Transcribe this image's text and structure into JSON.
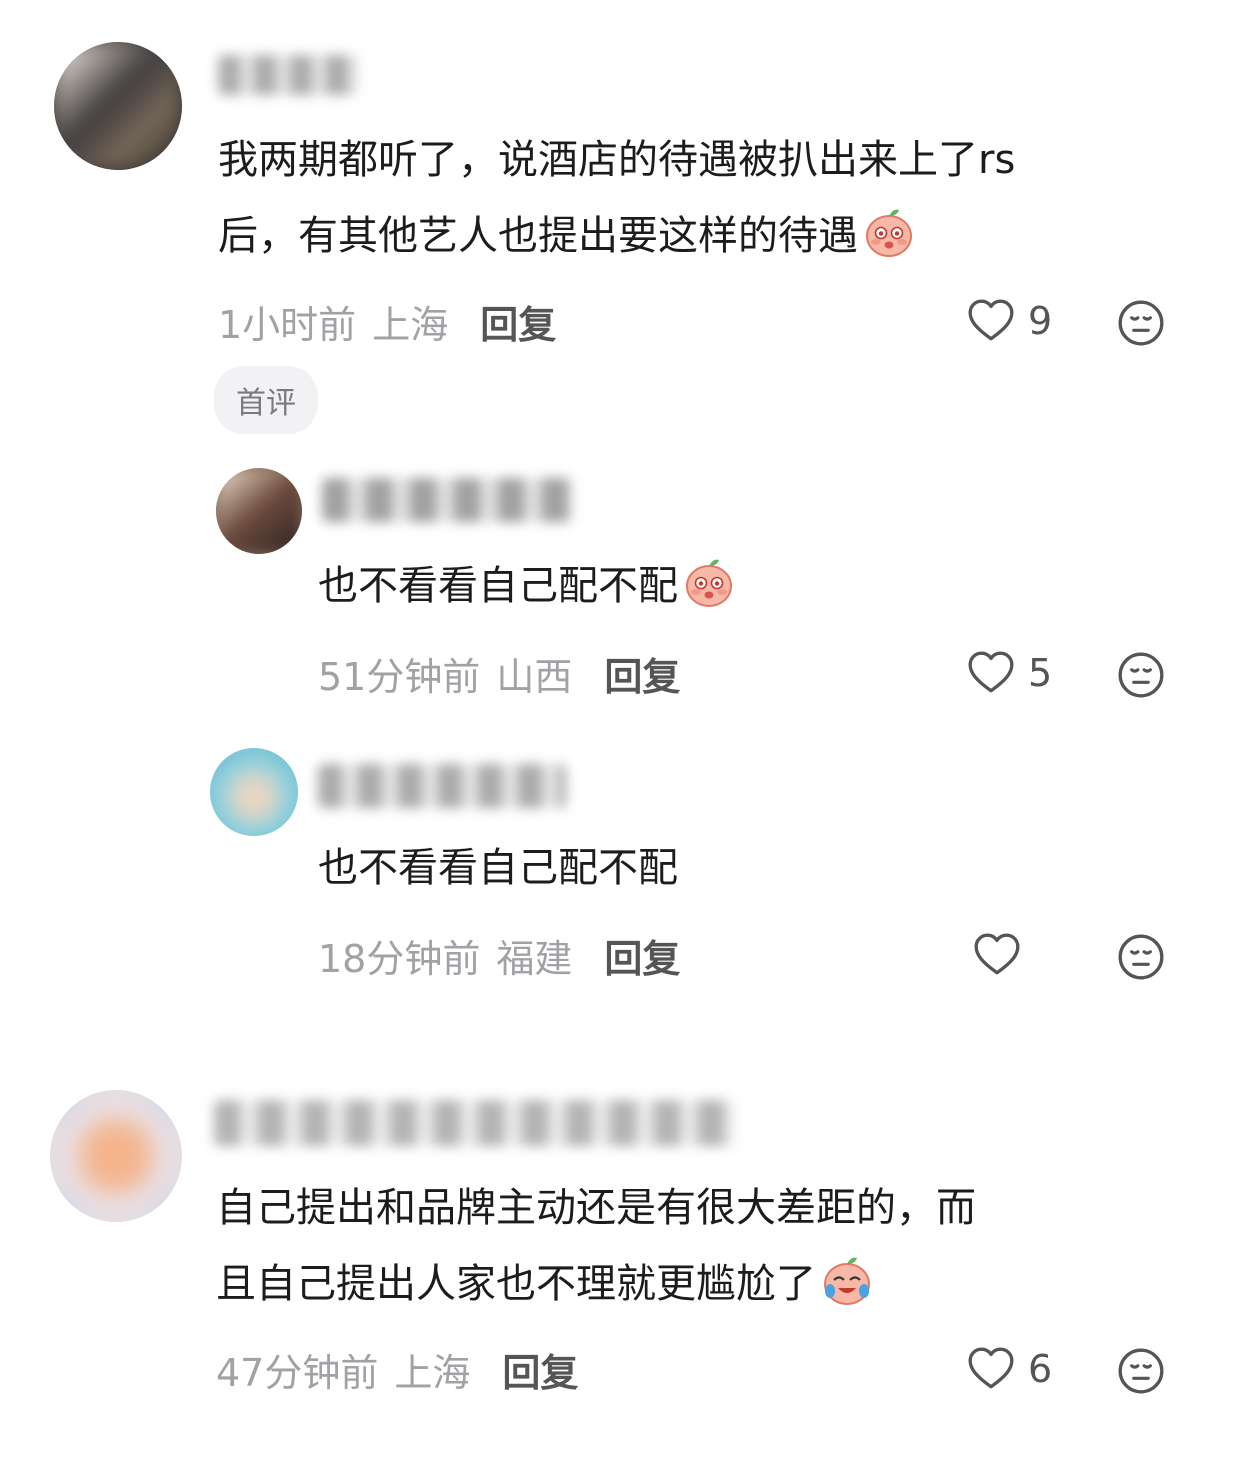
{
  "comments": [
    {
      "text_line1": "我两期都听了，说酒店的待遇被扒出来上了rs",
      "text_line2": "后，有其他艺人也提出要这样的待遇",
      "time": "1小时前",
      "location": "上海",
      "reply_label": "回复",
      "likes": "9",
      "badge": "首评",
      "replies": [
        {
          "text": "也不看看自己配不配",
          "time": "51分钟前",
          "location": "山西",
          "reply_label": "回复",
          "likes": "5"
        },
        {
          "text": "也不看看自己配不配",
          "time": "18分钟前",
          "location": "福建",
          "reply_label": "回复",
          "likes": ""
        }
      ]
    },
    {
      "text_line1": "自己提出和品牌主动还是有很大差距的，而",
      "text_line2": "且自己提出人家也不理就更尴尬了",
      "time": "47分钟前",
      "location": "上海",
      "reply_label": "回复",
      "likes": "6"
    }
  ],
  "icons": {
    "like": "heart-outline-icon",
    "dislike": "meh-face-icon",
    "emoji_blush": "peach-blush-emoji",
    "emoji_cry": "peach-laugh-cry-emoji"
  },
  "colors": {
    "meta": "#a1a1a6",
    "text": "#1c1c1c",
    "badge_bg": "#f2f2f4"
  }
}
